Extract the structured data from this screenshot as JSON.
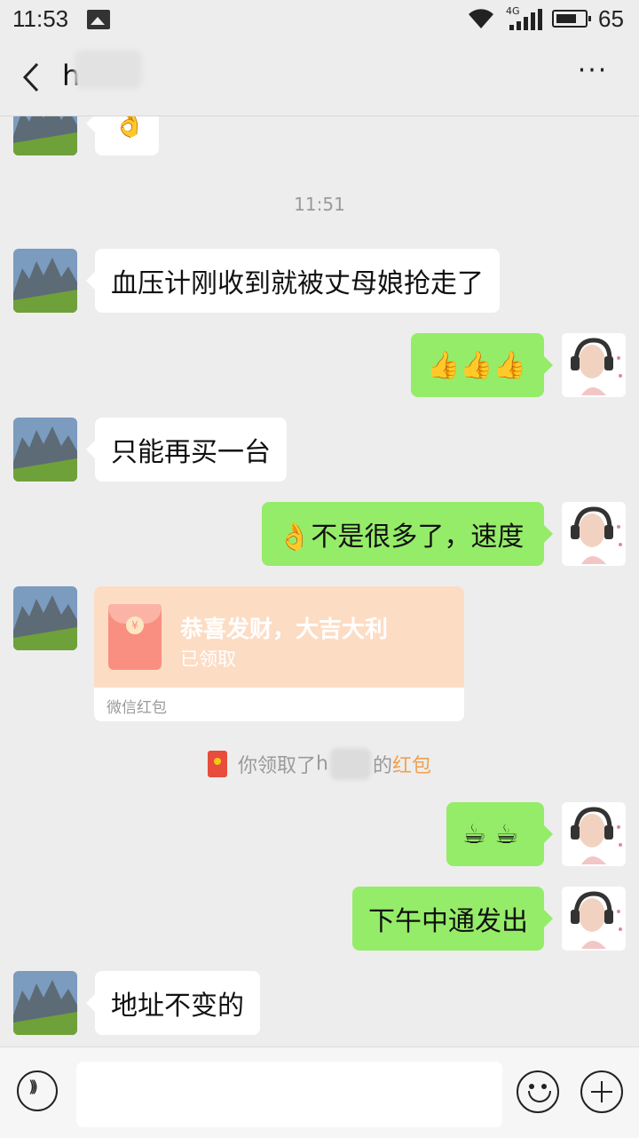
{
  "status_bar": {
    "time": "11:53",
    "network": "4G",
    "battery": "65"
  },
  "header": {
    "title": "h",
    "more": "···"
  },
  "timestamp": "11:51",
  "messages": [
    {
      "side": "left",
      "text": "👌"
    },
    {
      "side": "left",
      "text": "血压计刚收到就被丈母娘抢走了"
    },
    {
      "side": "right",
      "text": "👍👍👍"
    },
    {
      "side": "left",
      "text": "只能再买一台"
    },
    {
      "side": "right",
      "text": "👌不是很多了，速度"
    },
    {
      "side": "right",
      "text": "☕ ☕"
    },
    {
      "side": "right",
      "text": "下午中通发出"
    },
    {
      "side": "left",
      "text": "地址不变的"
    }
  ],
  "red_packet": {
    "greeting": "恭喜发财，大吉大利",
    "status": "已领取",
    "footer": "微信红包",
    "coin": "¥"
  },
  "system_note": {
    "prefix": "你领取了",
    "name": "h",
    "suffix": "的",
    "link": "红包"
  },
  "input_bar": {
    "placeholder": ""
  },
  "colors": {
    "sent_bubble": "#95ec69",
    "received_bubble": "#ffffff",
    "background": "#ededed",
    "red_packet": "#fddcc4"
  }
}
